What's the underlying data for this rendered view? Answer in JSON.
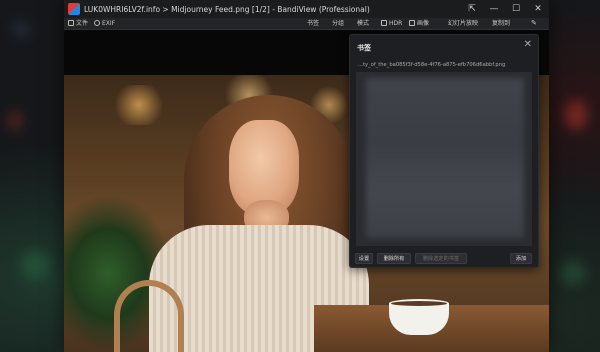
{
  "window": {
    "title": "LUK0WHRI6LV2f.info > Midjourney Feed.png [1/2] - BandiView (Professional)",
    "controls": {
      "pin": "⇱",
      "minimize": "—",
      "maximize": "☐",
      "close": "✕"
    }
  },
  "menubar": {
    "left": [
      {
        "label": "文件",
        "icon": "file-icon"
      },
      {
        "label": "EXIF",
        "icon": "info-icon"
      }
    ],
    "right": [
      {
        "label": "书签"
      },
      {
        "label": "分组"
      },
      {
        "label": "模式"
      },
      {
        "label": "HDR",
        "icon": "hdr-icon"
      },
      {
        "label": "画像",
        "icon": "image-icon"
      },
      {
        "label": "幻灯片放映"
      },
      {
        "label": "复制到"
      }
    ],
    "pin_icon": "pin-icon"
  },
  "bookmark_panel": {
    "title": "书签",
    "close_icon": "✕",
    "file_name": "...ty_of_the_ba085f3f-d58e-4f76-a875-efb706d6abbf.png",
    "buttons": {
      "settings": "设置",
      "delete_all": "删除所有",
      "delete_selected": "删除选定的书签",
      "add": "添加"
    }
  }
}
